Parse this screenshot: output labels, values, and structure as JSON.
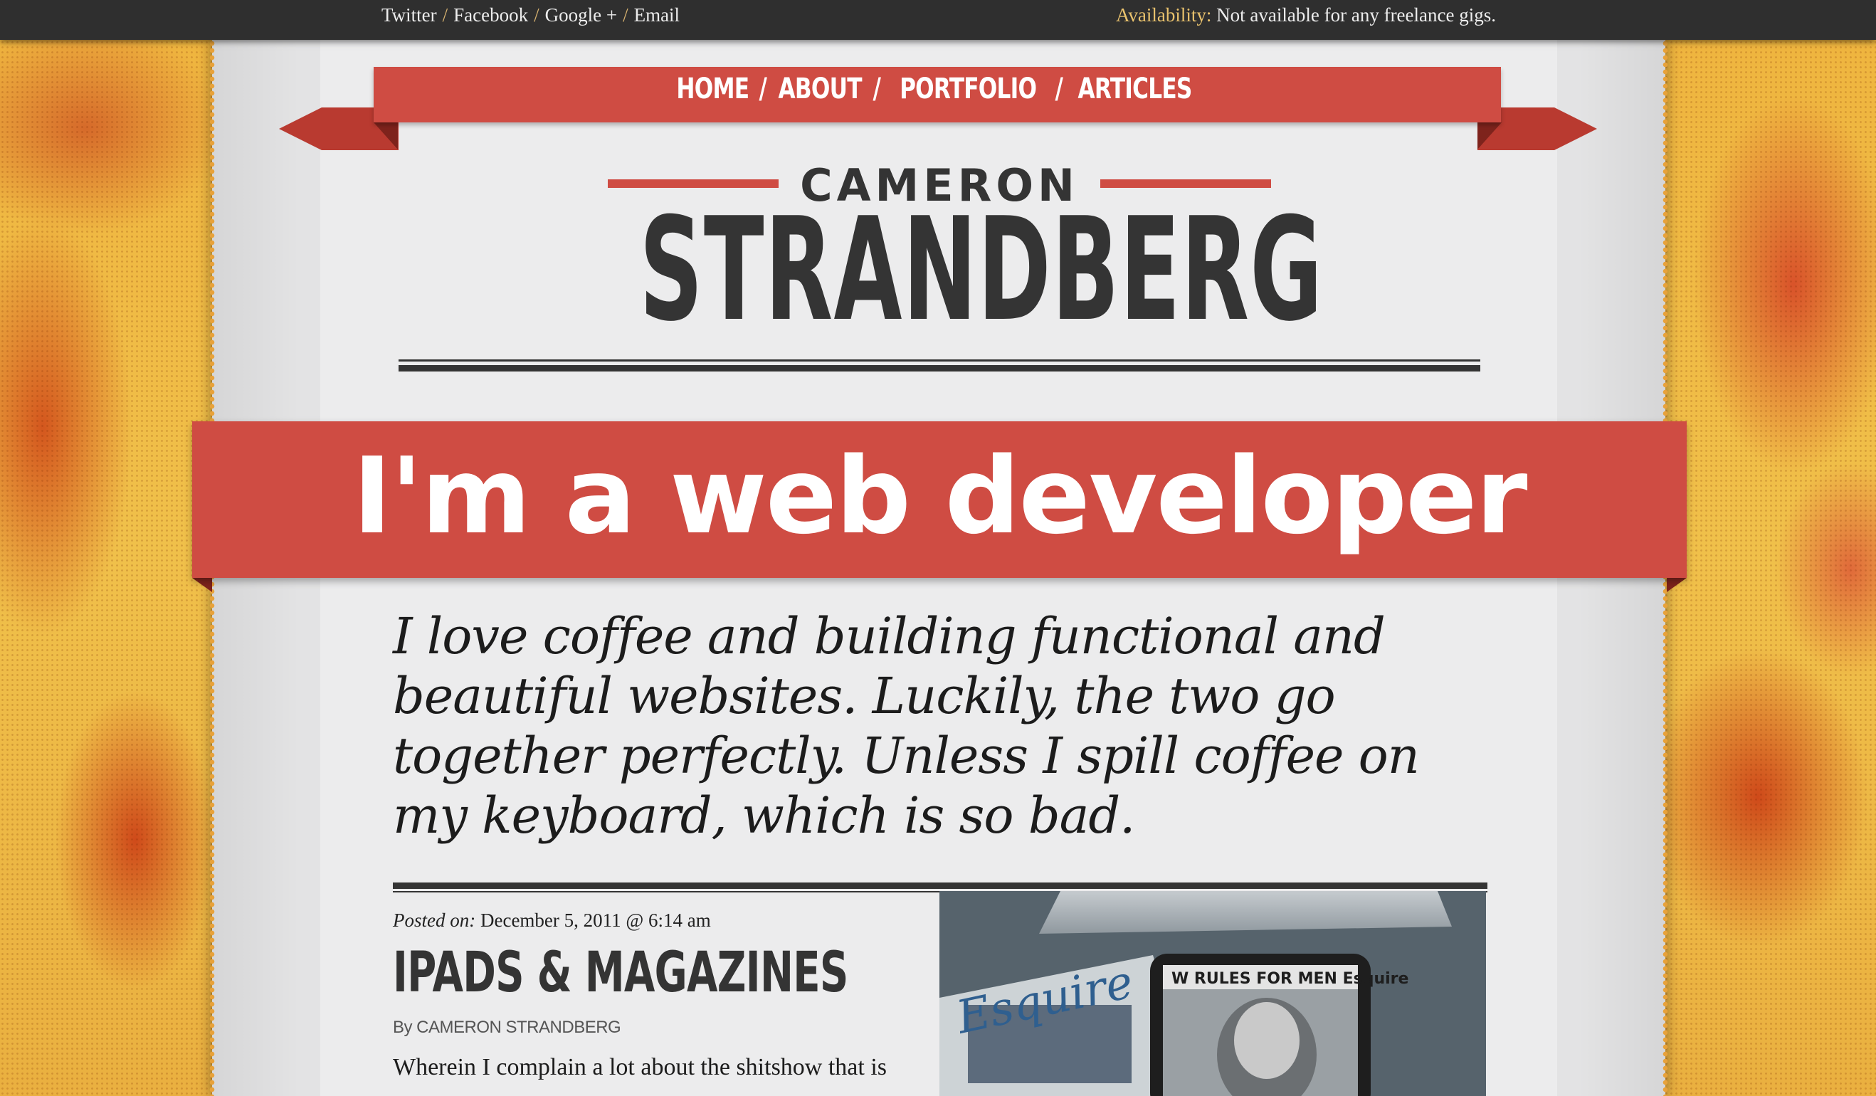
{
  "topbar": {
    "social_links": [
      "Twitter",
      "Facebook",
      "Google +",
      "Email"
    ],
    "separator": "/",
    "availability_label": "Availability:",
    "availability_text": "Not available for any freelance gigs."
  },
  "nav": {
    "items": [
      "HOME",
      "ABOUT",
      "PORTFOLIO",
      "ARTICLES"
    ],
    "separator": "/"
  },
  "logo": {
    "first_name": "CAMERON",
    "last_name": "STRANDBERG"
  },
  "headline": "I'm a web developer",
  "intro": "I love coffee and building functional and beautiful websites. Luckily, the two go together perfectly. Unless I spill coffee on my keyboard, which is so bad.",
  "post": {
    "posted_label": "Posted on:",
    "posted_date": "December 5, 2011 @ 6:14 am",
    "title": "IPADS & MAGAZINES",
    "author": "By CAMERON STRANDBERG",
    "excerpt": "Wherein I complain a lot about the shitshow that is",
    "image_text_left": "Esquire",
    "image_text_right": "W RULES FOR MEN Esquire"
  },
  "colors": {
    "accent_red": "#cf4c43",
    "dark_text": "#343434",
    "topbar": "#2f2f2f",
    "availability_label": "#e9c26d"
  }
}
